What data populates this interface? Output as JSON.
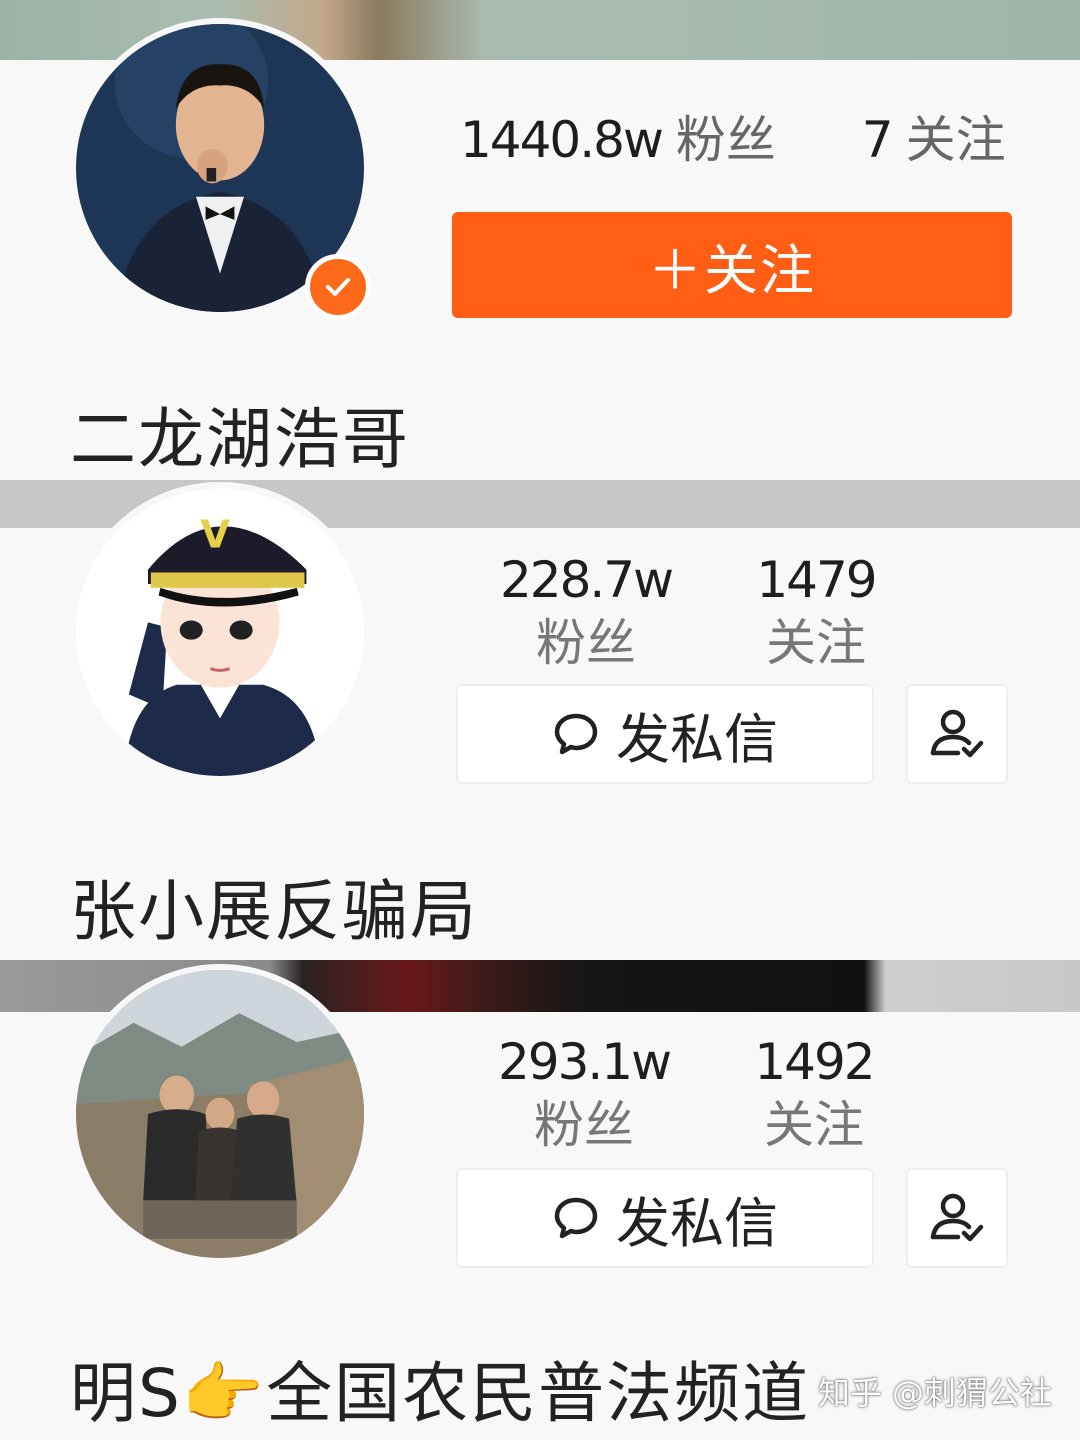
{
  "profiles": [
    {
      "name": "二龙湖浩哥",
      "followers": "1440.8w",
      "followers_label": "粉丝",
      "following": "7",
      "following_label": "关注",
      "follow_button": "＋关注",
      "verified": true
    },
    {
      "name": "张小展反骗局",
      "followers": "228.7w",
      "followers_label": "粉丝",
      "following": "1479",
      "following_label": "关注",
      "message_button": "发私信"
    },
    {
      "name": "明S👉全国农民普法频道",
      "followers": "293.1w",
      "followers_label": "粉丝",
      "following": "1492",
      "following_label": "关注",
      "message_button": "发私信"
    }
  ],
  "watermark": "知乎 @刺猬公社",
  "colors": {
    "accent": "#ff5e14",
    "verified_badge": "#ff6a1a"
  },
  "icons": [
    "check-icon",
    "chat-bubble-icon",
    "user-check-icon"
  ]
}
